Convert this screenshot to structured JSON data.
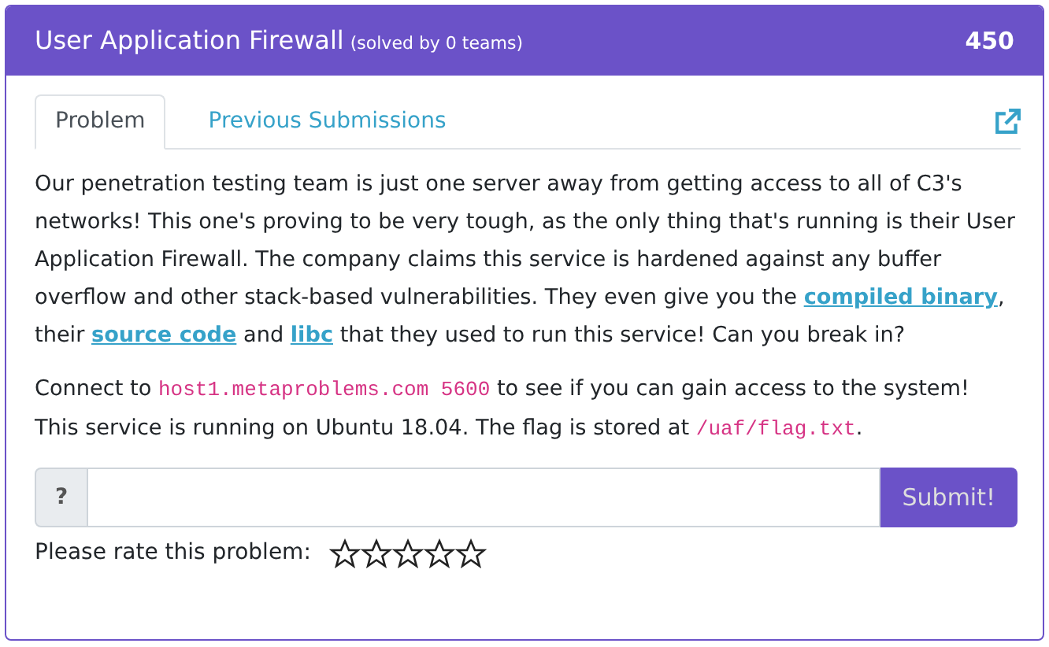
{
  "challenge": {
    "title": "User Application Firewall",
    "solved": "(solved by 0 teams)",
    "points": "450"
  },
  "tabs": [
    {
      "label": "Problem",
      "selected": true
    },
    {
      "label": "Previous Submissions",
      "selected": false
    }
  ],
  "description": [
    [
      {
        "kind": "text",
        "text": "Our penetration testing team is just one server away from getting access to all of C3's networks! This one's proving to be very tough, as the only thing that's running is their User Application Firewall. The company claims this service is hardened against any buffer overflow and other stack-based vulnerabilities. They even give you the "
      },
      {
        "kind": "link",
        "text": "compiled binary"
      },
      {
        "kind": "text",
        "text": ", their "
      },
      {
        "kind": "link",
        "text": "source code"
      },
      {
        "kind": "text",
        "text": " and "
      },
      {
        "kind": "link",
        "text": "libc"
      },
      {
        "kind": "text",
        "text": " that they used to run this service! Can you break in?"
      }
    ],
    [
      {
        "kind": "text",
        "text": "Connect to "
      },
      {
        "kind": "code",
        "text": "host1.metaproblems.com 5600"
      },
      {
        "kind": "text",
        "text": " to see if you can gain access to the system! This service is running on Ubuntu 18.04. The flag is stored at "
      },
      {
        "kind": "code",
        "text": "/uaf/flag.txt"
      },
      {
        "kind": "text",
        "text": "."
      }
    ]
  ],
  "flag_form": {
    "prefix": "?",
    "button": "Submit!"
  },
  "rating": {
    "label": "Please rate this problem:",
    "stars": 0
  }
}
